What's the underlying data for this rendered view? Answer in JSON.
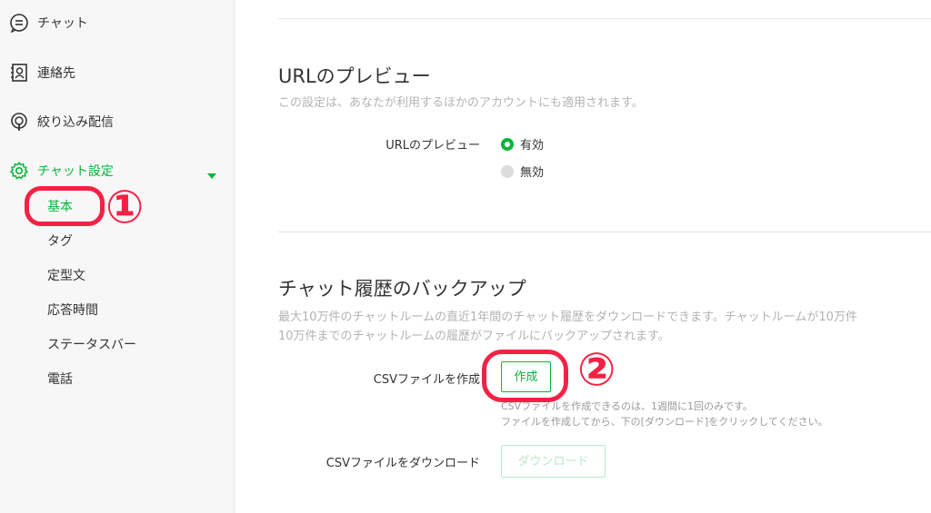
{
  "sidebar": {
    "items": [
      {
        "label": "チャット",
        "icon": "chat-bubble-icon"
      },
      {
        "label": "連絡先",
        "icon": "contact-card-icon"
      },
      {
        "label": "絞り込み配信",
        "icon": "broadcast-icon"
      },
      {
        "label": "チャット設定",
        "icon": "gear-icon"
      }
    ],
    "sub_items": [
      "基本",
      "タグ",
      "定型文",
      "応答時間",
      "ステータスバー",
      "電話"
    ]
  },
  "annotations": {
    "one": "①",
    "two": "②"
  },
  "url_preview": {
    "title": "URLのプレビュー",
    "description": "この設定は、あなたが利用するほかのアカウントにも適用されます。",
    "row_label": "URLのプレビュー",
    "options": [
      "有効",
      "無効"
    ],
    "selected": "有効"
  },
  "backup": {
    "title": "チャット履歴のバックアップ",
    "description_line1": "最大10万件のチャットルームの直近1年間のチャット履歴をダウンロードできます。チャットルームが10万件",
    "description_line2": "10万件までのチャットルームの履歴がファイルにバックアップされます。",
    "create_label": "CSVファイルを作成",
    "create_button": "作成",
    "note_line1": "CSVファイルを作成できるのは、1週間に1回のみです。",
    "note_line2": "ファイルを作成してから、下の[ダウンロード]をクリックしてください。",
    "download_label": "CSVファイルをダウンロード",
    "download_button": "ダウンロード"
  },
  "colors": {
    "accent": "#06b53b",
    "annotation": "#f32244"
  }
}
